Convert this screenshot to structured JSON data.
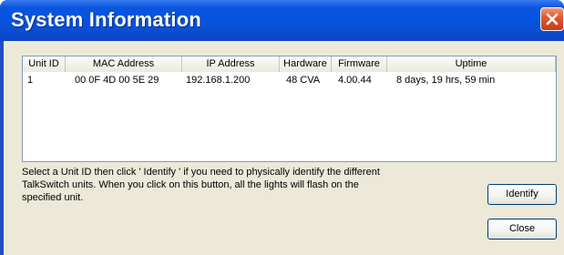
{
  "window": {
    "title": "System Information"
  },
  "table": {
    "columns": [
      "Unit ID",
      "MAC Address",
      "IP Address",
      "Hardware",
      "Firmware",
      "Uptime"
    ],
    "rows": [
      [
        "1",
        "00 0F 4D 00 5E 29",
        "192.168.1.200",
        "48 CVA",
        "4.00.44",
        "8 days, 19 hrs, 59 min"
      ]
    ]
  },
  "info_text": "Select a Unit ID then click ' Identify ' if you need to physically identify the different\nTalkSwitch units. When you click on this button, all the lights will flash on the\nspecified unit.",
  "buttons": {
    "identify": "Identify",
    "close": "Close"
  }
}
